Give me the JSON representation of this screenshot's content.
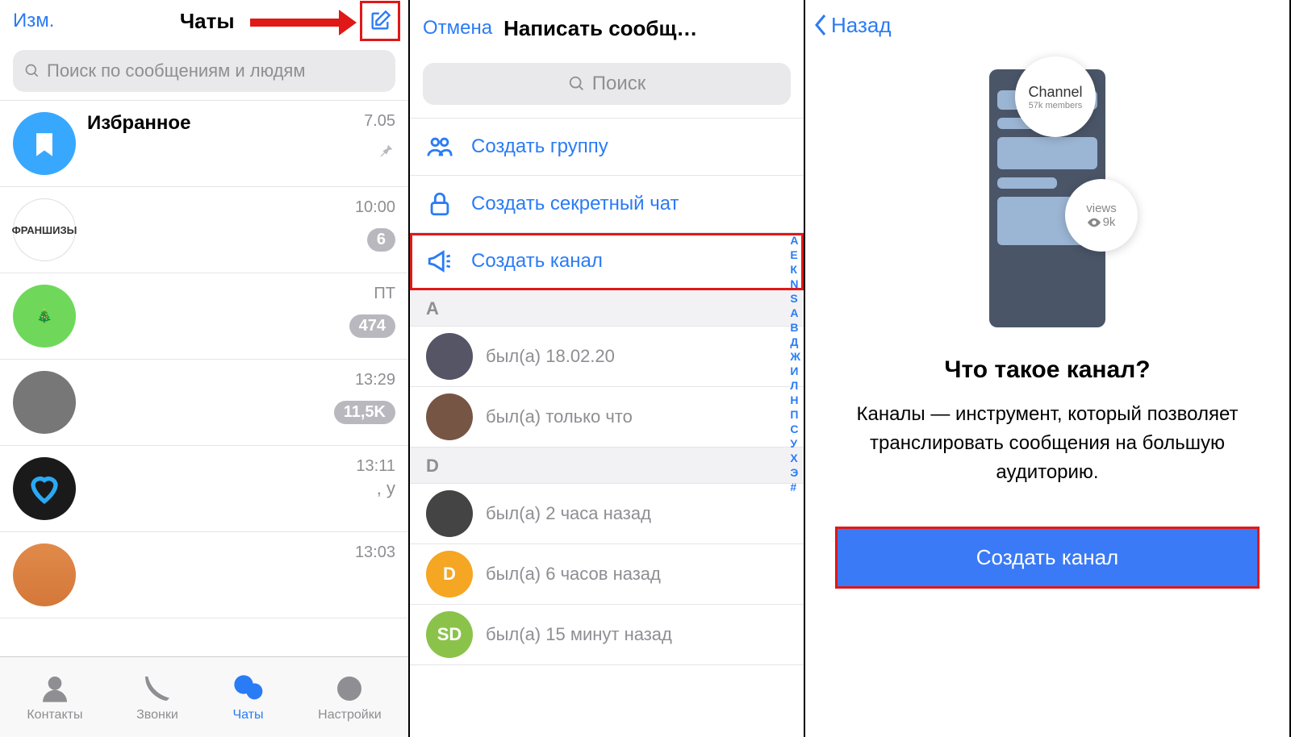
{
  "panel1": {
    "edit": "Изм.",
    "title": "Чаты",
    "search_placeholder": "Поиск по сообщениям и людям",
    "chats": [
      {
        "name": "Избранное",
        "time": "7.05",
        "pin": true
      },
      {
        "name_img": "ФРАНШИЗЫ",
        "time": "10:00",
        "badge": "6",
        "snippet": "..."
      },
      {
        "time": "ПТ",
        "badge": "474"
      },
      {
        "time": "13:29",
        "badge": "11,5K"
      },
      {
        "time": "13:11",
        "snippet": ", у"
      },
      {
        "time": "13:03"
      }
    ],
    "tabs": [
      "Контакты",
      "Звонки",
      "Чаты",
      "Настройки"
    ]
  },
  "panel2": {
    "cancel": "Отмена",
    "title": "Написать сообщ…",
    "search_placeholder": "Поиск",
    "actions": [
      "Создать группу",
      "Создать секретный чат",
      "Создать канал"
    ],
    "sections": [
      {
        "letter": "A",
        "contacts": [
          {
            "status": "был(а) 18.02.20"
          },
          {
            "status": "был(а) только что"
          }
        ]
      },
      {
        "letter": "D",
        "contacts": [
          {
            "status": "был(а) 2 часа назад"
          },
          {
            "initials": "D",
            "color": "#f5a623",
            "status": "был(а) 6 часов назад"
          },
          {
            "initials": "SD",
            "color": "#8bc34a",
            "status": "был(а) 15 минут назад"
          }
        ]
      }
    ],
    "index": [
      "А",
      "Е",
      "К",
      "N",
      "S",
      "А",
      "В",
      "Д",
      "Ж",
      "И",
      "Л",
      "Н",
      "П",
      "С",
      "У",
      "Х",
      "Э",
      "#"
    ]
  },
  "panel3": {
    "back": "Назад",
    "illus": {
      "channel": "Channel",
      "members": "57k members",
      "views": "views",
      "view_count": "9k"
    },
    "question": "Что такое канал?",
    "desc": "Каналы — инструмент, который позволяет транслировать сообщения\nна большую аудиторию.",
    "button": "Создать канал"
  }
}
